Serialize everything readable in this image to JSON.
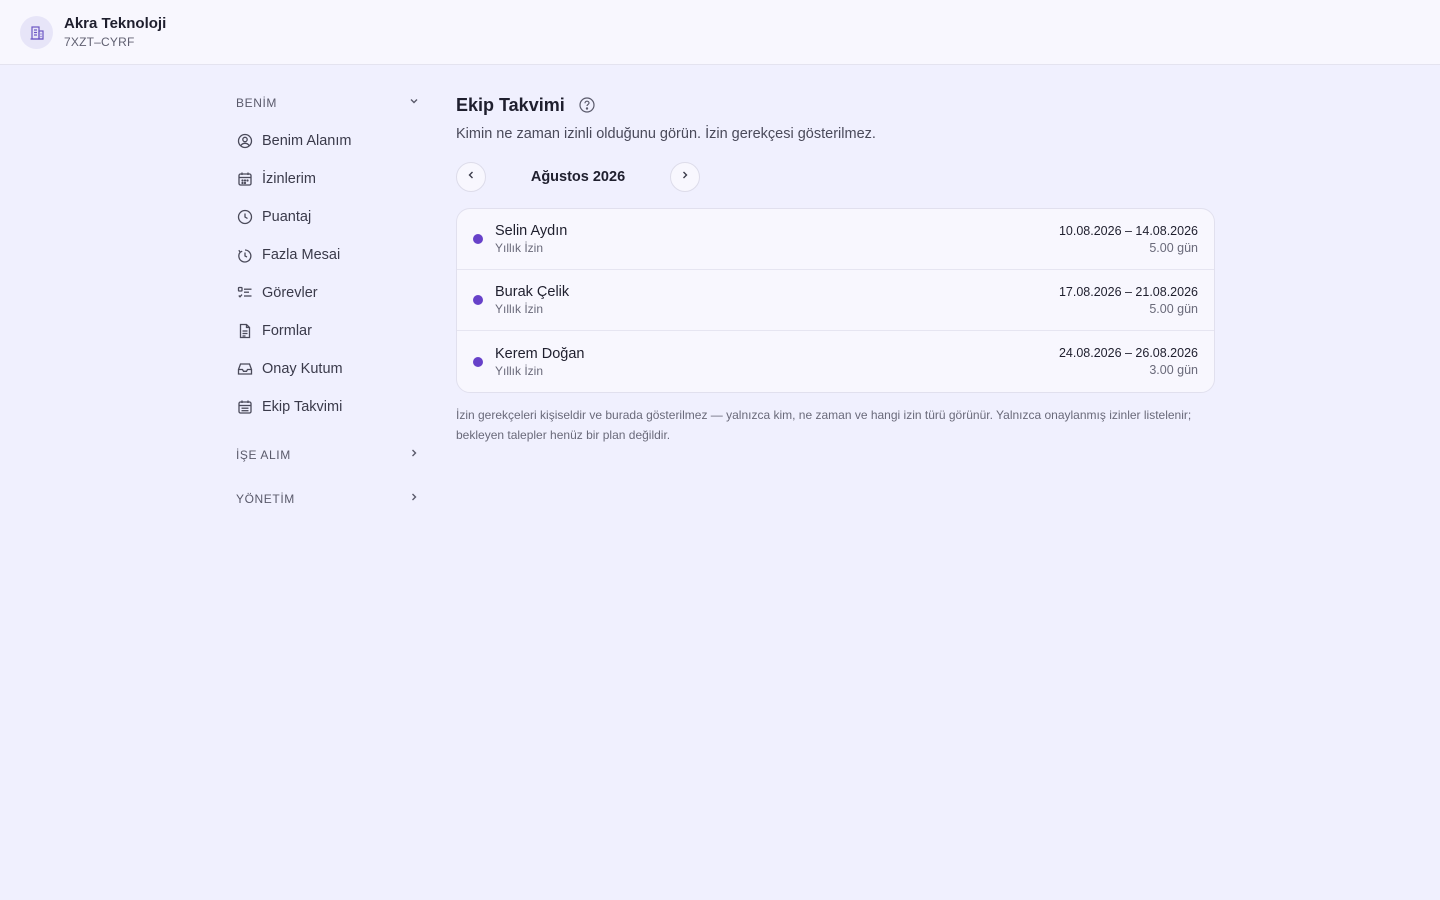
{
  "org": {
    "name": "Akra Teknoloji",
    "code": "7XZT–CYRF"
  },
  "sidebar": {
    "sections": [
      {
        "label": "BENİM",
        "expanded": true,
        "items": [
          {
            "label": "Benim Alanım",
            "icon": "user-circle-icon"
          },
          {
            "label": "İzinlerim",
            "icon": "calendar-icon"
          },
          {
            "label": "Puantaj",
            "icon": "clock-icon"
          },
          {
            "label": "Fazla Mesai",
            "icon": "stopwatch-icon"
          },
          {
            "label": "Görevler",
            "icon": "task-list-icon"
          },
          {
            "label": "Formlar",
            "icon": "document-icon"
          },
          {
            "label": "Onay Kutum",
            "icon": "inbox-icon"
          },
          {
            "label": "Ekip Takvimi",
            "icon": "calendar-grid-icon"
          }
        ]
      },
      {
        "label": "İŞE ALIM",
        "expanded": false
      },
      {
        "label": "YÖNETİM",
        "expanded": false
      }
    ]
  },
  "main": {
    "title": "Ekip Takvimi",
    "subtitle": "Kimin ne zaman izinli olduğunu görün. İzin gerekçesi gösterilmez.",
    "month": "Ağustos 2026",
    "entries": [
      {
        "name": "Selin Aydın",
        "type": "Yıllık İzin",
        "range": "10.08.2026 – 14.08.2026",
        "duration": "5.00 gün"
      },
      {
        "name": "Burak Çelik",
        "type": "Yıllık İzin",
        "range": "17.08.2026 – 21.08.2026",
        "duration": "5.00 gün"
      },
      {
        "name": "Kerem Doğan",
        "type": "Yıllık İzin",
        "range": "24.08.2026 – 26.08.2026",
        "duration": "3.00 gün"
      }
    ],
    "footnote": "İzin gerekçeleri kişiseldir ve burada gösterilmez — yalnızca kim, ne zaman ve hangi izin türü görünür. Yalnızca onaylanmış izinler listelenir; bekleyen talepler henüz bir plan değildir."
  },
  "colors": {
    "accent": "#6741c9",
    "background": "#f0f0fe",
    "surface": "#f8f7fe"
  }
}
